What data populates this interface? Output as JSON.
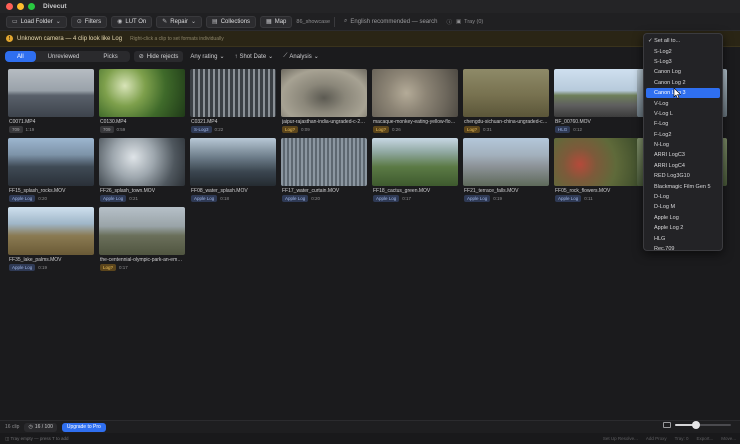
{
  "window": {
    "title": "Divecut"
  },
  "toolbar": {
    "load_folder": "Load Folder",
    "filters": "Filters",
    "lut": "LUT On",
    "repair": "Repair",
    "collections": "Collections",
    "map": "Map",
    "folder_name": "86_showcase",
    "search_placeholder": "English recommended — search",
    "tray": "Tray (0)"
  },
  "banner": {
    "title": "Unknown camera — 4 clip look like Log",
    "hint": "Right-click a clip to set formats individually"
  },
  "filters": {
    "tabs": [
      "All",
      "Unreviewed",
      "Picks"
    ],
    "hide_rejects": "Hide rejects",
    "any_rating": "Any rating",
    "shot_date": "Shot Date",
    "analysis": "Analysis"
  },
  "clips": [
    {
      "name": "C0071.MP4",
      "badge": "709",
      "duration": "1:19"
    },
    {
      "name": "C0130.MP4",
      "badge": "709",
      "duration": "0:59"
    },
    {
      "name": "C0321.MP4",
      "badge": "S-Log3",
      "duration": "0:22"
    },
    {
      "name": "jaipur-rajasthan-india-ungraded-c-202...",
      "badge": "Log?",
      "duration": "0:09"
    },
    {
      "name": "macaque-monkey-eating-yellow-flower...",
      "badge": "Log?",
      "duration": "0:26"
    },
    {
      "name": "chengdu-sichuan-china-ungraded-c-20...",
      "badge": "Log?",
      "duration": "0:31"
    },
    {
      "name": "BF_00760.MOV",
      "badge": "HLG",
      "duration": "0:12"
    },
    {
      "name": "FF15_splash_rocks.MOV",
      "badge": "Apple Log",
      "duration": "0:20"
    },
    {
      "name": "FF26_splash_town.MOV",
      "badge": "Apple Log",
      "duration": "0:21"
    },
    {
      "name": "FF08_water_splash.MOV",
      "badge": "Apple Log",
      "duration": "0:18"
    },
    {
      "name": "FF17_water_curtain.MOV",
      "badge": "Apple Log",
      "duration": "0:20"
    },
    {
      "name": "FF18_cactus_green.MOV",
      "badge": "Apple Log",
      "duration": "0:17"
    },
    {
      "name": "FF21_terrace_falls.MOV",
      "badge": "Apple Log",
      "duration": "0:19"
    },
    {
      "name": "FF05_rock_flowers.MOV",
      "badge": "Apple Log",
      "duration": "0:11"
    },
    {
      "name": "FF35_lake_palms.MOV",
      "badge": "Apple Log",
      "duration": "0:19"
    },
    {
      "name": "the-centennial-olympic-park-an-emble...",
      "badge": "Log?",
      "duration": "0:17"
    }
  ],
  "dropdown": {
    "header": "✓ Set all to...",
    "items": [
      "S-Log2",
      "S-Log3",
      "Canon Log",
      "Canon Log 2",
      "Canon Log 3",
      "V-Log",
      "V-Log L",
      "F-Log",
      "F-Log2",
      "N-Log",
      "ARRI LogC3",
      "ARRI LogC4",
      "RED Log3G10",
      "Blackmagic Film Gen 5",
      "D-Log",
      "D-Log M",
      "Apple Log",
      "Apple Log 2",
      "HLG",
      "Rec.709"
    ],
    "highlighted": "Canon Log 3"
  },
  "bottom": {
    "clip_count": "16 clip",
    "page": "16 / 100",
    "upgrade": "Upgrade to Pro",
    "zoom_level": 0.38
  },
  "status": {
    "left": "Tray empty — press T to add",
    "right": [
      "Set Up Resolve...",
      "Add Proxy",
      "Tray: 0",
      "Export...",
      "Move..."
    ]
  },
  "colors": {
    "accent": "#2f6ff0",
    "warning": "#e3a72f"
  }
}
